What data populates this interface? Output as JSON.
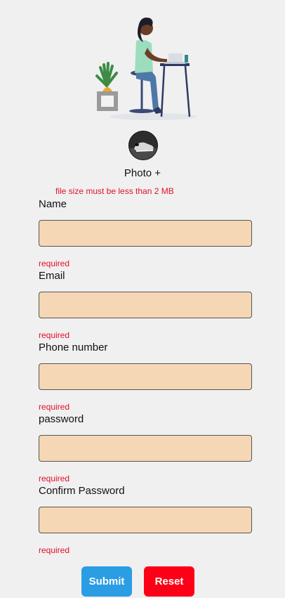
{
  "photo": {
    "label": "Photo +",
    "error": "file size must be less than 2 MB"
  },
  "fields": [
    {
      "label": "Name",
      "value": "",
      "error": "required"
    },
    {
      "label": "Email",
      "value": "",
      "error": "required"
    },
    {
      "label": "Phone number",
      "value": "",
      "error": "required"
    },
    {
      "label": "password",
      "value": "",
      "error": "required"
    },
    {
      "label": "Confirm Password",
      "value": "",
      "error": "required"
    }
  ],
  "buttons": {
    "submit": "Submit",
    "reset": "Reset"
  },
  "colors": {
    "input_bg": "#f5d7b5",
    "error": "#e0102a",
    "submit": "#2a9de3",
    "reset": "#fc0017"
  }
}
